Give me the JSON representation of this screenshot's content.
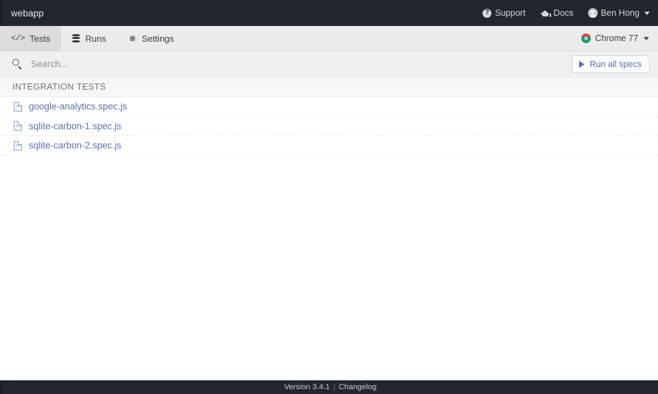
{
  "topbar": {
    "project_title": "webapp",
    "support_label": "Support",
    "support_icon": "question-circle-icon",
    "docs_label": "Docs",
    "docs_icon": "graduation-cap-icon",
    "user_name": "Ben Hong",
    "user_icon": "avatar-icon",
    "background": "#22262e"
  },
  "nav": {
    "tabs": [
      {
        "label": "Tests",
        "icon": "code-brackets-icon",
        "active": true
      },
      {
        "label": "Runs",
        "icon": "database-stack-icon",
        "active": false
      },
      {
        "label": "Settings",
        "icon": "gear-icon",
        "active": false
      }
    ],
    "browser": {
      "label": "Chrome 77",
      "icon": "chrome-icon",
      "icon_color": "#1aa260"
    }
  },
  "search": {
    "value": "",
    "placeholder": "Search...",
    "icon": "search-icon"
  },
  "run_all": {
    "label": "Run all specs",
    "icon": "play-icon",
    "accent": "#5a6fa8"
  },
  "specs": {
    "section_title": "INTEGRATION TESTS",
    "files": [
      {
        "name": "google-analytics.spec.js",
        "icon": "js-file-icon"
      },
      {
        "name": "sqlite-carbon-1.spec.js",
        "icon": "js-file-icon"
      },
      {
        "name": "sqlite-carbon-2.spec.js",
        "icon": "js-file-icon"
      }
    ]
  },
  "footer": {
    "version": "Version 3.4.1",
    "separator": "|",
    "changelog_label": "Changelog"
  }
}
